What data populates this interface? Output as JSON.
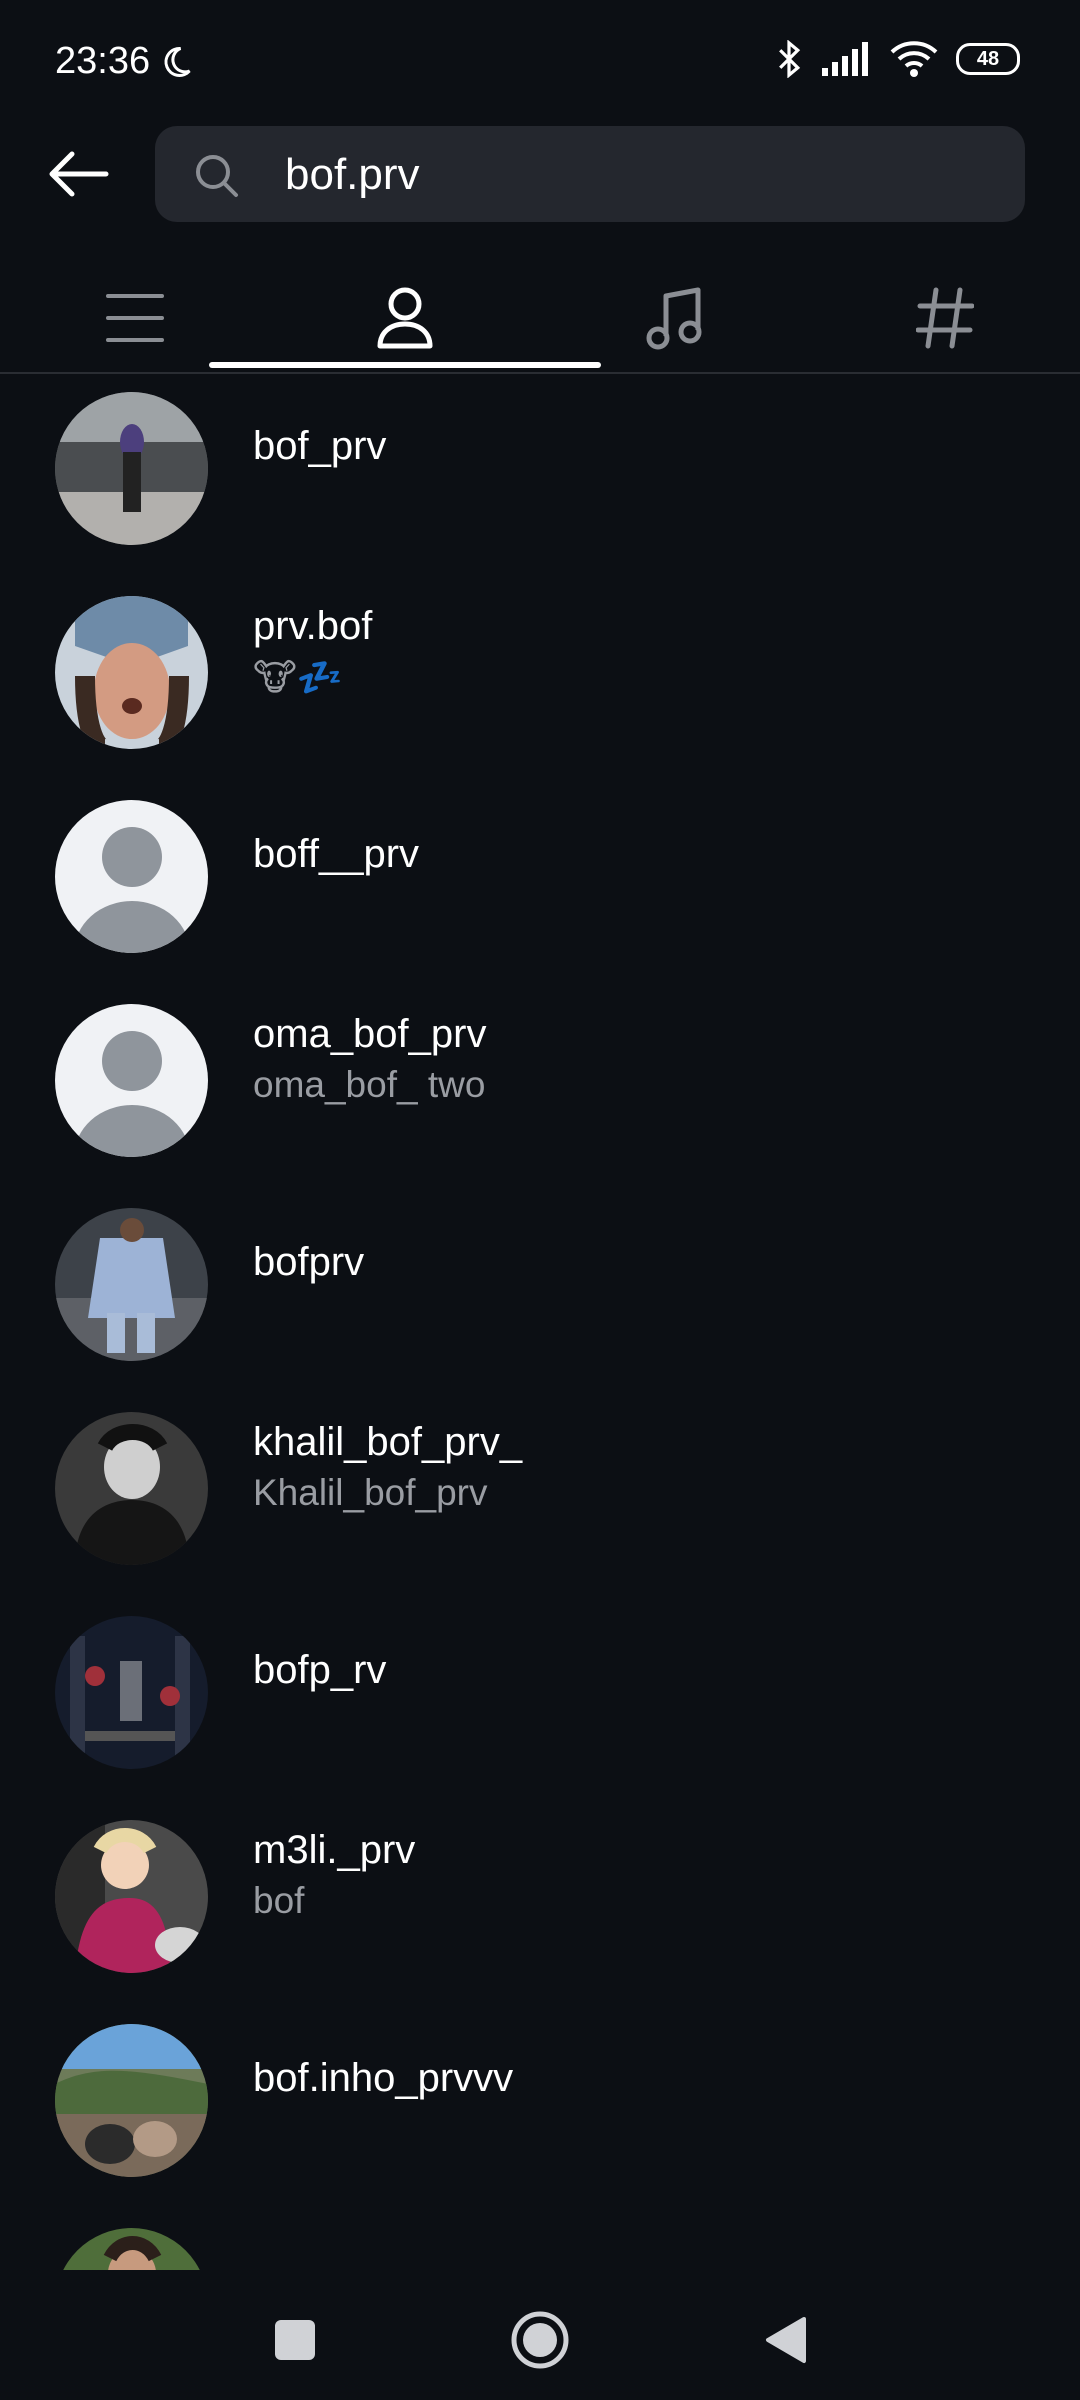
{
  "status_bar": {
    "time": "23:36",
    "battery": "48"
  },
  "search": {
    "query": "bof.prv"
  },
  "tabs": [
    {
      "name": "top-tab",
      "icon": "list-icon"
    },
    {
      "name": "accounts-tab",
      "icon": "person-icon",
      "selected": true
    },
    {
      "name": "audio-tab",
      "icon": "music-note-icon"
    },
    {
      "name": "tags-tab",
      "icon": "hashtag-icon"
    }
  ],
  "results": [
    {
      "username": "bof_prv",
      "fullname": "",
      "avatar": "photo"
    },
    {
      "username": "prv.bof",
      "fullname": "🐮💤",
      "avatar": "photo"
    },
    {
      "username": "boff__prv",
      "fullname": "",
      "avatar": "default"
    },
    {
      "username": "oma_bof_prv",
      "fullname": "oma_bof_ two",
      "avatar": "default"
    },
    {
      "username": "bofprv",
      "fullname": "",
      "avatar": "photo"
    },
    {
      "username": "khalil_bof_prv_",
      "fullname": "Khalil_bof_prv",
      "avatar": "photo"
    },
    {
      "username": "bofp_rv",
      "fullname": "",
      "avatar": "photo"
    },
    {
      "username": "m3li._prv",
      "fullname": "bof",
      "avatar": "photo"
    },
    {
      "username": "bof.inho_prvvv",
      "fullname": "",
      "avatar": "photo"
    }
  ],
  "colors": {
    "background": "#0c0f14",
    "search_bg": "#24272e",
    "secondary_text": "#9a9da3"
  }
}
